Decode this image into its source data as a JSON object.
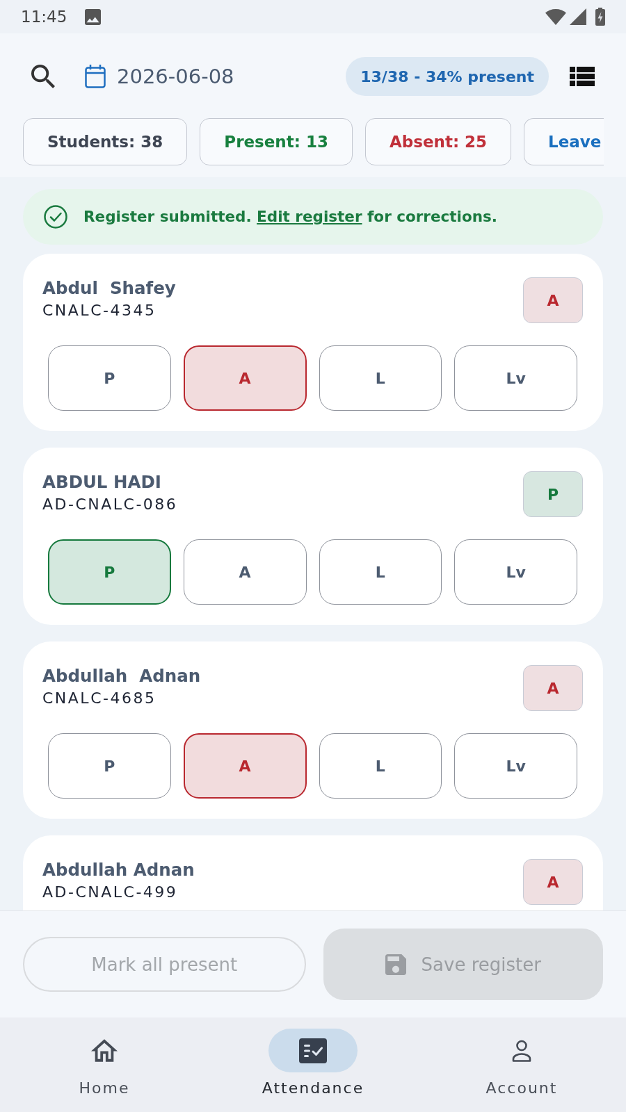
{
  "status_bar": {
    "time": "11:45"
  },
  "header": {
    "date": "2026-06-08",
    "summary": "13/38 - 34% present"
  },
  "chips": [
    {
      "label": "Students: 38",
      "kind": "total"
    },
    {
      "label": "Present: 13",
      "kind": "present"
    },
    {
      "label": "Absent: 25",
      "kind": "absent"
    },
    {
      "label": "Leave",
      "kind": "leave"
    }
  ],
  "banner": {
    "text_before": "Register submitted.",
    "link": "Edit register",
    "text_after": "for corrections."
  },
  "students": [
    {
      "name": "Abdul  Shafey",
      "id": "CNALC-4345",
      "badge": {
        "label": "A",
        "kind": "absent"
      },
      "options": [
        {
          "label": "P",
          "selected": false
        },
        {
          "label": "A",
          "selected": true
        },
        {
          "label": "L",
          "selected": false
        },
        {
          "label": "Lv",
          "selected": false
        }
      ]
    },
    {
      "name": "ABDUL HADI",
      "id": "AD-CNALC-086",
      "badge": {
        "label": "P",
        "kind": "present"
      },
      "options": [
        {
          "label": "P",
          "selected": true
        },
        {
          "label": "A",
          "selected": false
        },
        {
          "label": "L",
          "selected": false
        },
        {
          "label": "Lv",
          "selected": false
        }
      ]
    },
    {
      "name": "Abdullah  Adnan",
      "id": "CNALC-4685",
      "badge": {
        "label": "A",
        "kind": "absent"
      },
      "options": [
        {
          "label": "P",
          "selected": false
        },
        {
          "label": "A",
          "selected": true
        },
        {
          "label": "L",
          "selected": false
        },
        {
          "label": "Lv",
          "selected": false
        }
      ]
    },
    {
      "name": "Abdullah Adnan",
      "id": "AD-CNALC-499",
      "badge": {
        "label": "A",
        "kind": "absent"
      }
    }
  ],
  "actions": {
    "mark_all": {
      "label": "Mark all present",
      "disabled": true
    },
    "save": {
      "label": "Save register",
      "disabled": true
    }
  },
  "nav": [
    {
      "label": "Home",
      "selected": false
    },
    {
      "label": "Attendance",
      "selected": true
    },
    {
      "label": "Account",
      "selected": false
    }
  ]
}
